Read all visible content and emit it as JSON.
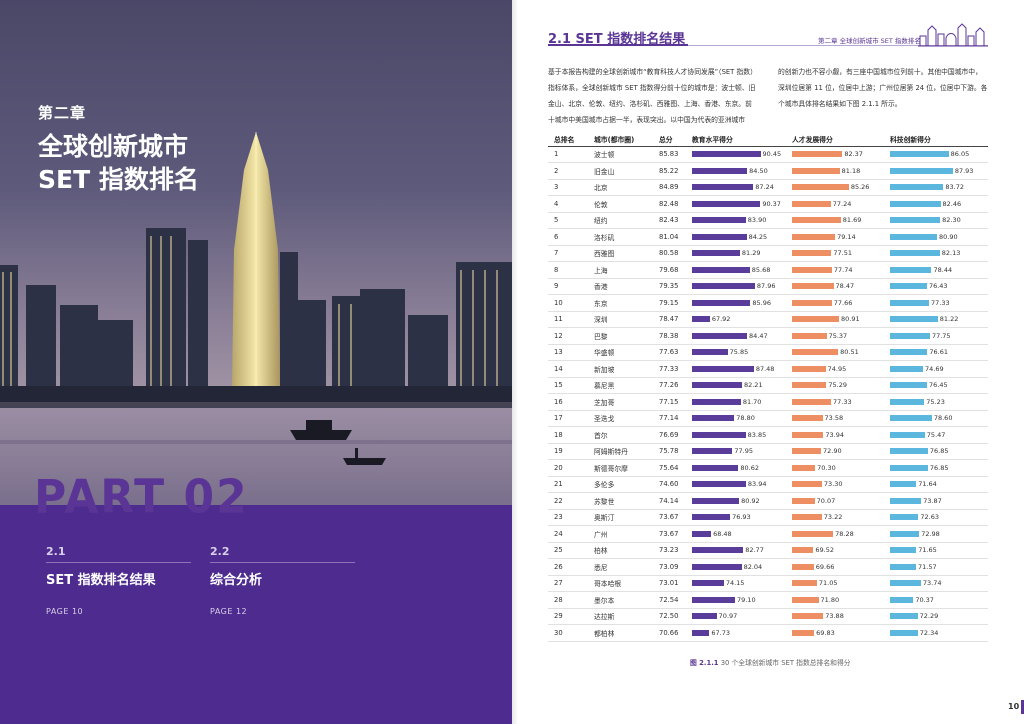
{
  "left": {
    "chapter": "第二章",
    "title_line1": "全球创新城市",
    "title_line2": "SET 指数排名",
    "part": "PART 02",
    "toc": [
      {
        "num": "2.1",
        "title": "SET 指数排名结果",
        "page": "PAGE 10"
      },
      {
        "num": "2.2",
        "title": "综合分析",
        "page": "PAGE 12"
      }
    ]
  },
  "right": {
    "section_title": "2.1  SET 指数排名结果",
    "header_chapter": "第二章  全球创新城市 SET 指数排名",
    "intro_col1": "基于本报告构建的全球创新城市“教育科技人才协同发展”（SET 指数）指标体系，全球创新城市 SET 指数得分前十位的城市是：波士顿、旧金山、北京、伦敦、纽约、洛杉矶、西雅图、上海、香港、东京。前十城市中美国城市占据一半，表现突出。以中国为代表的亚洲城市",
    "intro_col2": "的创新力也不容小觑，有三座中国城市位列前十。其他中国城市中，深圳位居第 11 位，位居中上游；广州位居第 24 位，位居中下游。各个城市具体排名结果如下图 2.1.1 所示。",
    "table_headers": [
      "总排名",
      "城市(都市圈)",
      "总分",
      "教育水平得分",
      "人才发展得分",
      "科技创新得分"
    ],
    "caption_fig": "图 2.1.1",
    "caption_text": "30 个全球创新城市 SET 指数总排名和得分",
    "page_number": "10"
  },
  "colors": {
    "education": "#5a3d9a",
    "talent": "#ee8f63",
    "technology": "#5cb7de",
    "brand": "#5a3595"
  },
  "chart_data": {
    "type": "table",
    "columns": [
      "总排名",
      "城市(都市圈)",
      "总分",
      "教育水平得分",
      "人才发展得分",
      "科技创新得分"
    ],
    "rows": [
      [
        "1",
        "波士顿",
        "85.83",
        "90.45",
        "82.37",
        "86.05"
      ],
      [
        "2",
        "旧金山",
        "85.22",
        "84.50",
        "81.18",
        "87.93"
      ],
      [
        "3",
        "北京",
        "84.89",
        "87.24",
        "85.26",
        "83.72"
      ],
      [
        "4",
        "伦敦",
        "82.48",
        "90.37",
        "77.24",
        "82.46"
      ],
      [
        "5",
        "纽约",
        "82.43",
        "83.90",
        "81.69",
        "82.30"
      ],
      [
        "6",
        "洛杉矶",
        "81.04",
        "84.25",
        "79.14",
        "80.90"
      ],
      [
        "7",
        "西雅图",
        "80.58",
        "81.29",
        "77.51",
        "82.13"
      ],
      [
        "8",
        "上海",
        "79.68",
        "85.68",
        "77.74",
        "78.44"
      ],
      [
        "9",
        "香港",
        "79.35",
        "87.96",
        "78.47",
        "76.43"
      ],
      [
        "10",
        "东京",
        "79.15",
        "85.96",
        "77.66",
        "77.33"
      ],
      [
        "11",
        "深圳",
        "78.47",
        "67.92",
        "80.91",
        "81.22"
      ],
      [
        "12",
        "巴黎",
        "78.38",
        "84.47",
        "75.37",
        "77.75"
      ],
      [
        "13",
        "华盛顿",
        "77.63",
        "75.85",
        "80.51",
        "76.61"
      ],
      [
        "14",
        "新加坡",
        "77.33",
        "87.48",
        "74.95",
        "74.69"
      ],
      [
        "15",
        "慕尼黑",
        "77.26",
        "82.21",
        "75.29",
        "76.45"
      ],
      [
        "16",
        "芝加哥",
        "77.15",
        "81.70",
        "77.33",
        "75.23"
      ],
      [
        "17",
        "圣迭戈",
        "77.14",
        "78.80",
        "73.58",
        "78.60"
      ],
      [
        "18",
        "首尔",
        "76.69",
        "83.85",
        "73.94",
        "75.47"
      ],
      [
        "19",
        "阿姆斯特丹",
        "75.78",
        "77.95",
        "72.90",
        "76.85"
      ],
      [
        "20",
        "斯德哥尔摩",
        "75.64",
        "80.62",
        "70.30",
        "76.85"
      ],
      [
        "21",
        "多伦多",
        "74.60",
        "83.94",
        "73.30",
        "71.64"
      ],
      [
        "22",
        "苏黎世",
        "74.14",
        "80.92",
        "70.07",
        "73.87"
      ],
      [
        "23",
        "奥斯汀",
        "73.67",
        "76.93",
        "73.22",
        "72.63"
      ],
      [
        "24",
        "广州",
        "73.67",
        "68.48",
        "78.28",
        "72.98"
      ],
      [
        "25",
        "柏林",
        "73.23",
        "82.77",
        "69.52",
        "71.65"
      ],
      [
        "26",
        "悉尼",
        "73.09",
        "82.04",
        "69.66",
        "71.57"
      ],
      [
        "27",
        "哥本哈根",
        "73.01",
        "74.15",
        "71.05",
        "73.74"
      ],
      [
        "28",
        "墨尔本",
        "72.54",
        "79.10",
        "71.80",
        "70.37"
      ],
      [
        "29",
        "达拉斯",
        "72.50",
        "70.97",
        "73.88",
        "72.29"
      ],
      [
        "30",
        "都柏林",
        "70.66",
        "67.73",
        "69.83",
        "72.34"
      ]
    ]
  }
}
